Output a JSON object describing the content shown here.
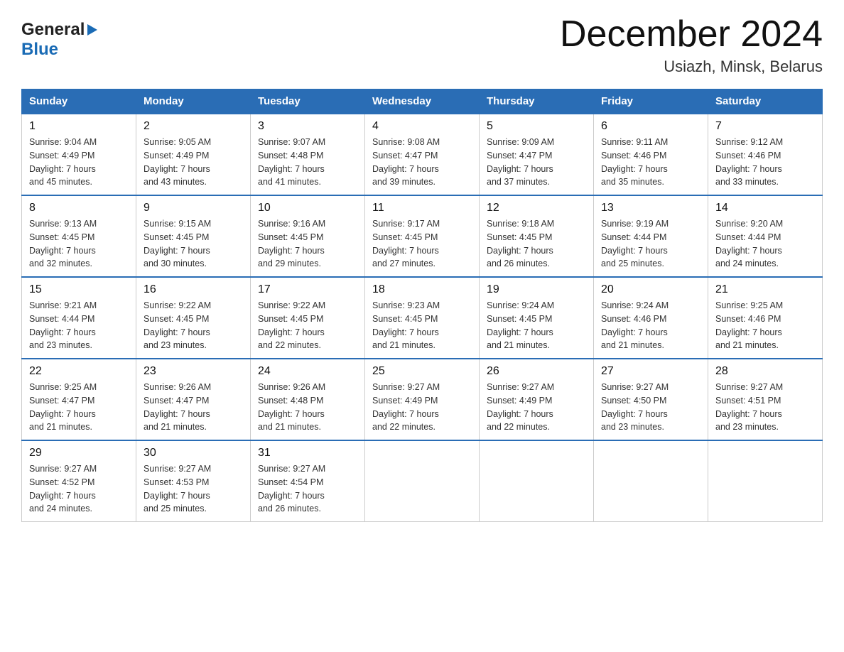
{
  "header": {
    "month_year": "December 2024",
    "location": "Usiazh, Minsk, Belarus"
  },
  "logo": {
    "general": "General",
    "blue": "Blue"
  },
  "columns": [
    "Sunday",
    "Monday",
    "Tuesday",
    "Wednesday",
    "Thursday",
    "Friday",
    "Saturday"
  ],
  "weeks": [
    [
      {
        "day": "1",
        "info": "Sunrise: 9:04 AM\nSunset: 4:49 PM\nDaylight: 7 hours\nand 45 minutes."
      },
      {
        "day": "2",
        "info": "Sunrise: 9:05 AM\nSunset: 4:49 PM\nDaylight: 7 hours\nand 43 minutes."
      },
      {
        "day": "3",
        "info": "Sunrise: 9:07 AM\nSunset: 4:48 PM\nDaylight: 7 hours\nand 41 minutes."
      },
      {
        "day": "4",
        "info": "Sunrise: 9:08 AM\nSunset: 4:47 PM\nDaylight: 7 hours\nand 39 minutes."
      },
      {
        "day": "5",
        "info": "Sunrise: 9:09 AM\nSunset: 4:47 PM\nDaylight: 7 hours\nand 37 minutes."
      },
      {
        "day": "6",
        "info": "Sunrise: 9:11 AM\nSunset: 4:46 PM\nDaylight: 7 hours\nand 35 minutes."
      },
      {
        "day": "7",
        "info": "Sunrise: 9:12 AM\nSunset: 4:46 PM\nDaylight: 7 hours\nand 33 minutes."
      }
    ],
    [
      {
        "day": "8",
        "info": "Sunrise: 9:13 AM\nSunset: 4:45 PM\nDaylight: 7 hours\nand 32 minutes."
      },
      {
        "day": "9",
        "info": "Sunrise: 9:15 AM\nSunset: 4:45 PM\nDaylight: 7 hours\nand 30 minutes."
      },
      {
        "day": "10",
        "info": "Sunrise: 9:16 AM\nSunset: 4:45 PM\nDaylight: 7 hours\nand 29 minutes."
      },
      {
        "day": "11",
        "info": "Sunrise: 9:17 AM\nSunset: 4:45 PM\nDaylight: 7 hours\nand 27 minutes."
      },
      {
        "day": "12",
        "info": "Sunrise: 9:18 AM\nSunset: 4:45 PM\nDaylight: 7 hours\nand 26 minutes."
      },
      {
        "day": "13",
        "info": "Sunrise: 9:19 AM\nSunset: 4:44 PM\nDaylight: 7 hours\nand 25 minutes."
      },
      {
        "day": "14",
        "info": "Sunrise: 9:20 AM\nSunset: 4:44 PM\nDaylight: 7 hours\nand 24 minutes."
      }
    ],
    [
      {
        "day": "15",
        "info": "Sunrise: 9:21 AM\nSunset: 4:44 PM\nDaylight: 7 hours\nand 23 minutes."
      },
      {
        "day": "16",
        "info": "Sunrise: 9:22 AM\nSunset: 4:45 PM\nDaylight: 7 hours\nand 23 minutes."
      },
      {
        "day": "17",
        "info": "Sunrise: 9:22 AM\nSunset: 4:45 PM\nDaylight: 7 hours\nand 22 minutes."
      },
      {
        "day": "18",
        "info": "Sunrise: 9:23 AM\nSunset: 4:45 PM\nDaylight: 7 hours\nand 21 minutes."
      },
      {
        "day": "19",
        "info": "Sunrise: 9:24 AM\nSunset: 4:45 PM\nDaylight: 7 hours\nand 21 minutes."
      },
      {
        "day": "20",
        "info": "Sunrise: 9:24 AM\nSunset: 4:46 PM\nDaylight: 7 hours\nand 21 minutes."
      },
      {
        "day": "21",
        "info": "Sunrise: 9:25 AM\nSunset: 4:46 PM\nDaylight: 7 hours\nand 21 minutes."
      }
    ],
    [
      {
        "day": "22",
        "info": "Sunrise: 9:25 AM\nSunset: 4:47 PM\nDaylight: 7 hours\nand 21 minutes."
      },
      {
        "day": "23",
        "info": "Sunrise: 9:26 AM\nSunset: 4:47 PM\nDaylight: 7 hours\nand 21 minutes."
      },
      {
        "day": "24",
        "info": "Sunrise: 9:26 AM\nSunset: 4:48 PM\nDaylight: 7 hours\nand 21 minutes."
      },
      {
        "day": "25",
        "info": "Sunrise: 9:27 AM\nSunset: 4:49 PM\nDaylight: 7 hours\nand 22 minutes."
      },
      {
        "day": "26",
        "info": "Sunrise: 9:27 AM\nSunset: 4:49 PM\nDaylight: 7 hours\nand 22 minutes."
      },
      {
        "day": "27",
        "info": "Sunrise: 9:27 AM\nSunset: 4:50 PM\nDaylight: 7 hours\nand 23 minutes."
      },
      {
        "day": "28",
        "info": "Sunrise: 9:27 AM\nSunset: 4:51 PM\nDaylight: 7 hours\nand 23 minutes."
      }
    ],
    [
      {
        "day": "29",
        "info": "Sunrise: 9:27 AM\nSunset: 4:52 PM\nDaylight: 7 hours\nand 24 minutes."
      },
      {
        "day": "30",
        "info": "Sunrise: 9:27 AM\nSunset: 4:53 PM\nDaylight: 7 hours\nand 25 minutes."
      },
      {
        "day": "31",
        "info": "Sunrise: 9:27 AM\nSunset: 4:54 PM\nDaylight: 7 hours\nand 26 minutes."
      },
      {
        "day": "",
        "info": ""
      },
      {
        "day": "",
        "info": ""
      },
      {
        "day": "",
        "info": ""
      },
      {
        "day": "",
        "info": ""
      }
    ]
  ]
}
